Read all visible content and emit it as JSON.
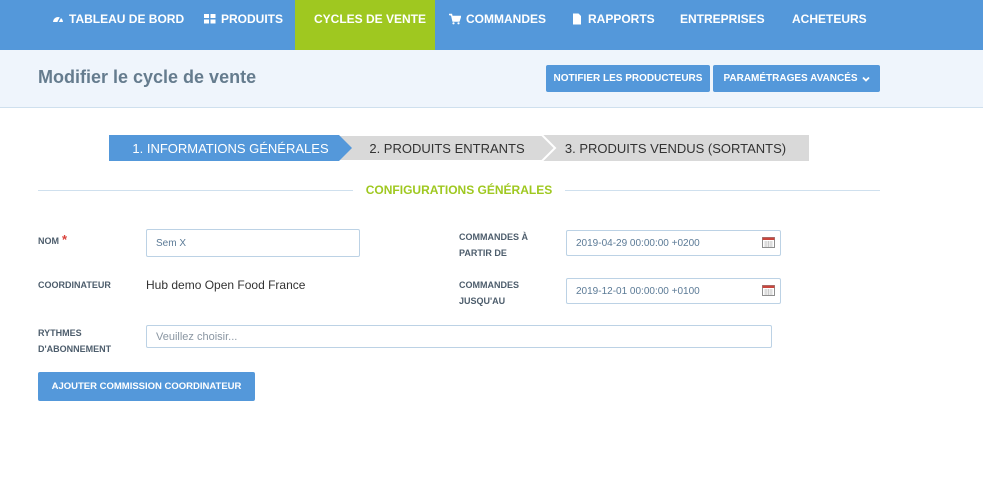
{
  "nav": {
    "items": [
      {
        "label": "TABLEAU DE BORD",
        "icon": "dashboard-icon"
      },
      {
        "label": "PRODUITS",
        "icon": "grid-icon"
      },
      {
        "label": "CYCLES DE VENTE",
        "icon": "refresh-icon",
        "active": true
      },
      {
        "label": "COMMANDES",
        "icon": "cart-icon"
      },
      {
        "label": "RAPPORTS",
        "icon": "file-icon"
      },
      {
        "label": "ENTREPRISES"
      },
      {
        "label": "ACHETEURS"
      }
    ]
  },
  "header": {
    "title": "Modifier le cycle de vente",
    "notify_label": "NOTIFIER LES PRODUCTEURS",
    "advanced_label": "PARAMÉTRAGES AVANCÉS"
  },
  "steps": [
    {
      "label": "1. INFORMATIONS GÉNÉRALES",
      "active": true
    },
    {
      "label": "2. PRODUITS ENTRANTS"
    },
    {
      "label": "3. PRODUITS VENDUS (SORTANTS)"
    }
  ],
  "section": {
    "title": "CONFIGURATIONS GÉNÉRALES"
  },
  "form": {
    "name_label": "NOM",
    "name_required": "*",
    "name_value": "Sem X",
    "coordinator_label": "COORDINATEUR",
    "coordinator_value": "Hub demo Open Food France",
    "rhythms_label_1": "RYTHMES",
    "rhythms_label_2": "D'ABONNEMENT",
    "rhythms_placeholder": "Veuillez choisir...",
    "orders_from_label_1": "COMMANDES À",
    "orders_from_label_2": "PARTIR DE",
    "orders_from_value": "2019-04-29 00:00:00 +0200",
    "orders_until_label_1": "COMMANDES",
    "orders_until_label_2": "JUSQU'AU",
    "orders_until_value": "2019-12-01 00:00:00 +0100",
    "commission_button": "AJOUTER COMMISSION COORDINATEUR"
  },
  "colors": {
    "primary": "#5498da",
    "accent": "#9fc820",
    "required": "#d9413a"
  }
}
